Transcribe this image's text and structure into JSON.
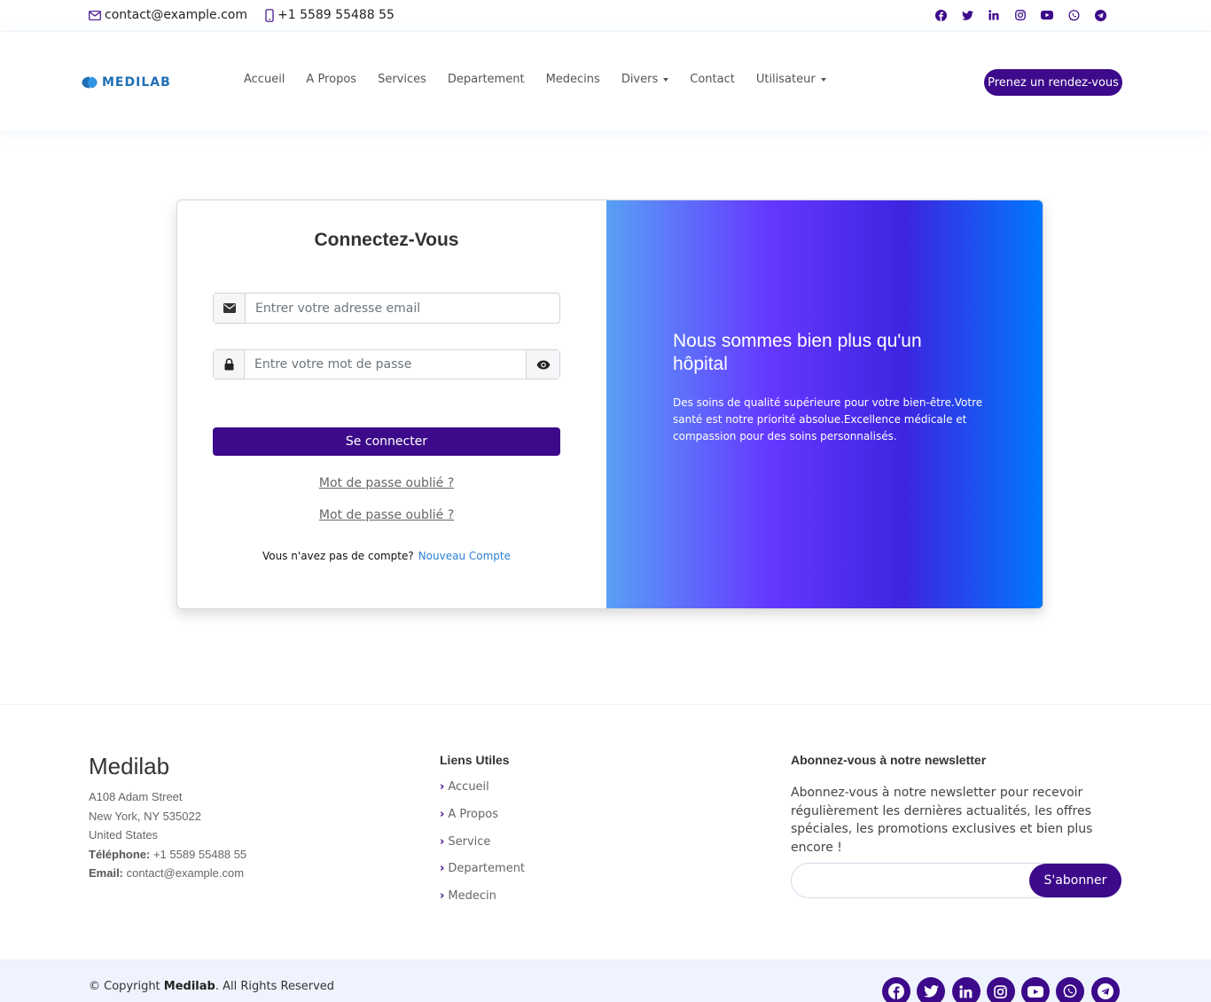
{
  "topbar": {
    "email": "contact@example.com",
    "phone": "+1 5589 55488 55",
    "socials": [
      "facebook-icon",
      "twitter-icon",
      "linkedin-icon",
      "instagram-icon",
      "youtube-icon",
      "whatsapp-icon",
      "telegram-icon"
    ],
    "accent_color": "#3c0a8a"
  },
  "header": {
    "logo_text": "MEDILAB",
    "nav": [
      {
        "label": "Accueil",
        "dropdown": false
      },
      {
        "label": "A Propos",
        "dropdown": false
      },
      {
        "label": "Services",
        "dropdown": false
      },
      {
        "label": "Departement",
        "dropdown": false
      },
      {
        "label": "Medecins",
        "dropdown": false
      },
      {
        "label": "Divers",
        "dropdown": true
      },
      {
        "label": "Contact",
        "dropdown": false
      },
      {
        "label": "Utilisateur",
        "dropdown": true
      }
    ],
    "appointment_button": "Prenez un rendez-vous"
  },
  "login": {
    "title": "Connectez-Vous",
    "email_placeholder": "Entrer votre adresse email",
    "password_placeholder": "Entre votre mot de passe",
    "submit_label": "Se connecter",
    "forgot_link_1": "Mot de passe oublié ?",
    "forgot_link_2": "Mot de passe oublié ?",
    "no_account_text": "Vous n'avez pas de compte?",
    "signup_link": "Nouveau Compte"
  },
  "promo": {
    "heading": "Nous sommes bien plus qu'un hôpital",
    "text": "Des soins de qualité supérieure pour votre bien-être.Votre santé est notre priorité absolue.Excellence médicale et compassion pour des soins personnalisés."
  },
  "footer": {
    "brand": "Medilab",
    "address_line1": "A108 Adam Street",
    "address_line2": "New York, NY 535022",
    "address_line3": "United States",
    "phone_label": "Téléphone:",
    "phone_value": "+1 5589 55488 55",
    "email_label": "Email:",
    "email_value": "contact@example.com",
    "links_title": "Liens Utiles",
    "links": [
      "Accueil",
      "A Propos",
      "Service",
      "Departement",
      "Medecin"
    ],
    "newsletter_title": "Abonnez-vous à notre newsletter",
    "newsletter_text": "Abonnez-vous à notre newsletter pour recevoir régulièrement les dernières actualités, les offres spéciales, les promotions exclusives et bien plus encore !",
    "subscribe_label": "S'abonner",
    "copyright_prefix": "© Copyright ",
    "copyright_brand": "Medilab",
    "copyright_suffix": ". All Rights Reserved"
  }
}
